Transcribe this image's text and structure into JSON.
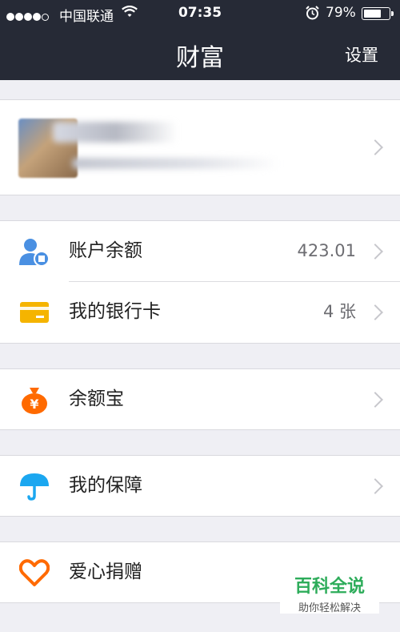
{
  "status_bar": {
    "carrier": "中国联通",
    "time": "07:35",
    "battery": "79%",
    "battery_level": 0.79
  },
  "header": {
    "title": "财富",
    "settings_label": "设置"
  },
  "menu": {
    "balance": {
      "label": "账户余额",
      "value": "423.01"
    },
    "bank_cards": {
      "label": "我的银行卡",
      "value": "4 张"
    },
    "yuebao": {
      "label": "余额宝"
    },
    "insurance": {
      "label": "我的保障"
    },
    "donation": {
      "label": "爱心捐赠"
    }
  },
  "watermark": {
    "title": "百科全说",
    "subtitle": "助你轻松解决"
  },
  "colors": {
    "navbar": "#262a36",
    "background": "#efeff4",
    "balance_icon": "#4a90e2",
    "bank_card_icon": "#f5b400",
    "yuebao_icon": "#ff6a00",
    "insurance_icon": "#1ba7f0",
    "donation_icon": "#ff6a00"
  }
}
